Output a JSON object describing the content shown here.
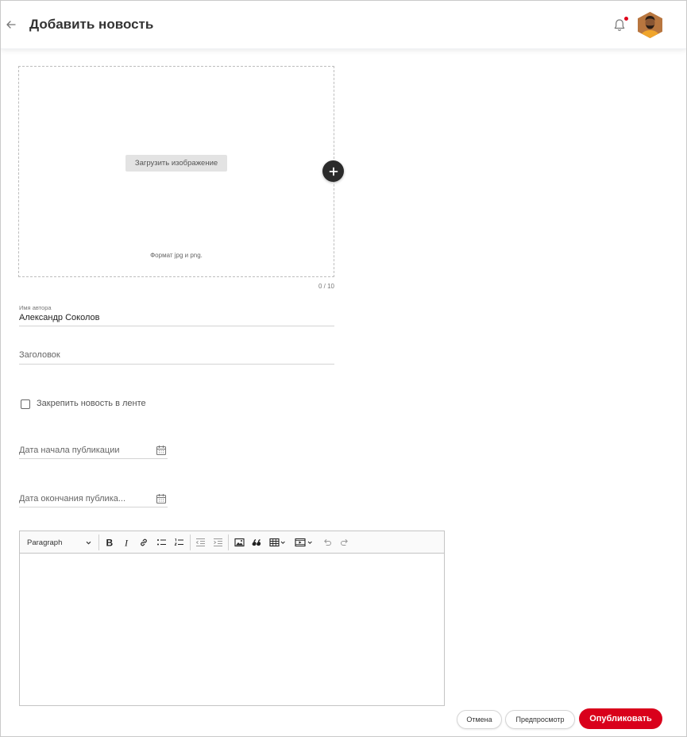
{
  "header": {
    "title": "Добавить новость"
  },
  "upload": {
    "button_label": "Загрузить изображение",
    "format_hint": "Формат jpg и png.",
    "counter": "0 / 10"
  },
  "form": {
    "author_label": "Имя автора",
    "author_value": "Александр Соколов",
    "title_placeholder": "Заголовок",
    "pin_label": "Закрепить новость в ленте",
    "start_date_placeholder": "Дата начала публикации",
    "end_date_placeholder": "Дата окончания публика..."
  },
  "editor": {
    "heading_select": "Paragraph"
  },
  "actions": {
    "cancel_label": "Отмена",
    "preview_label": "Предпросмотр",
    "publish_label": "Опубликовать"
  },
  "colors": {
    "accent": "#d9001b",
    "notification_dot": "#e0001a"
  },
  "icons": [
    "arrow-left-icon",
    "bell-icon",
    "plus-icon",
    "calendar-icon",
    "bold-icon",
    "italic-icon",
    "link-icon",
    "bulleted-list-icon",
    "numbered-list-icon",
    "outdent-icon",
    "indent-icon",
    "image-icon",
    "quote-icon",
    "table-icon",
    "media-icon",
    "undo-icon",
    "redo-icon"
  ]
}
